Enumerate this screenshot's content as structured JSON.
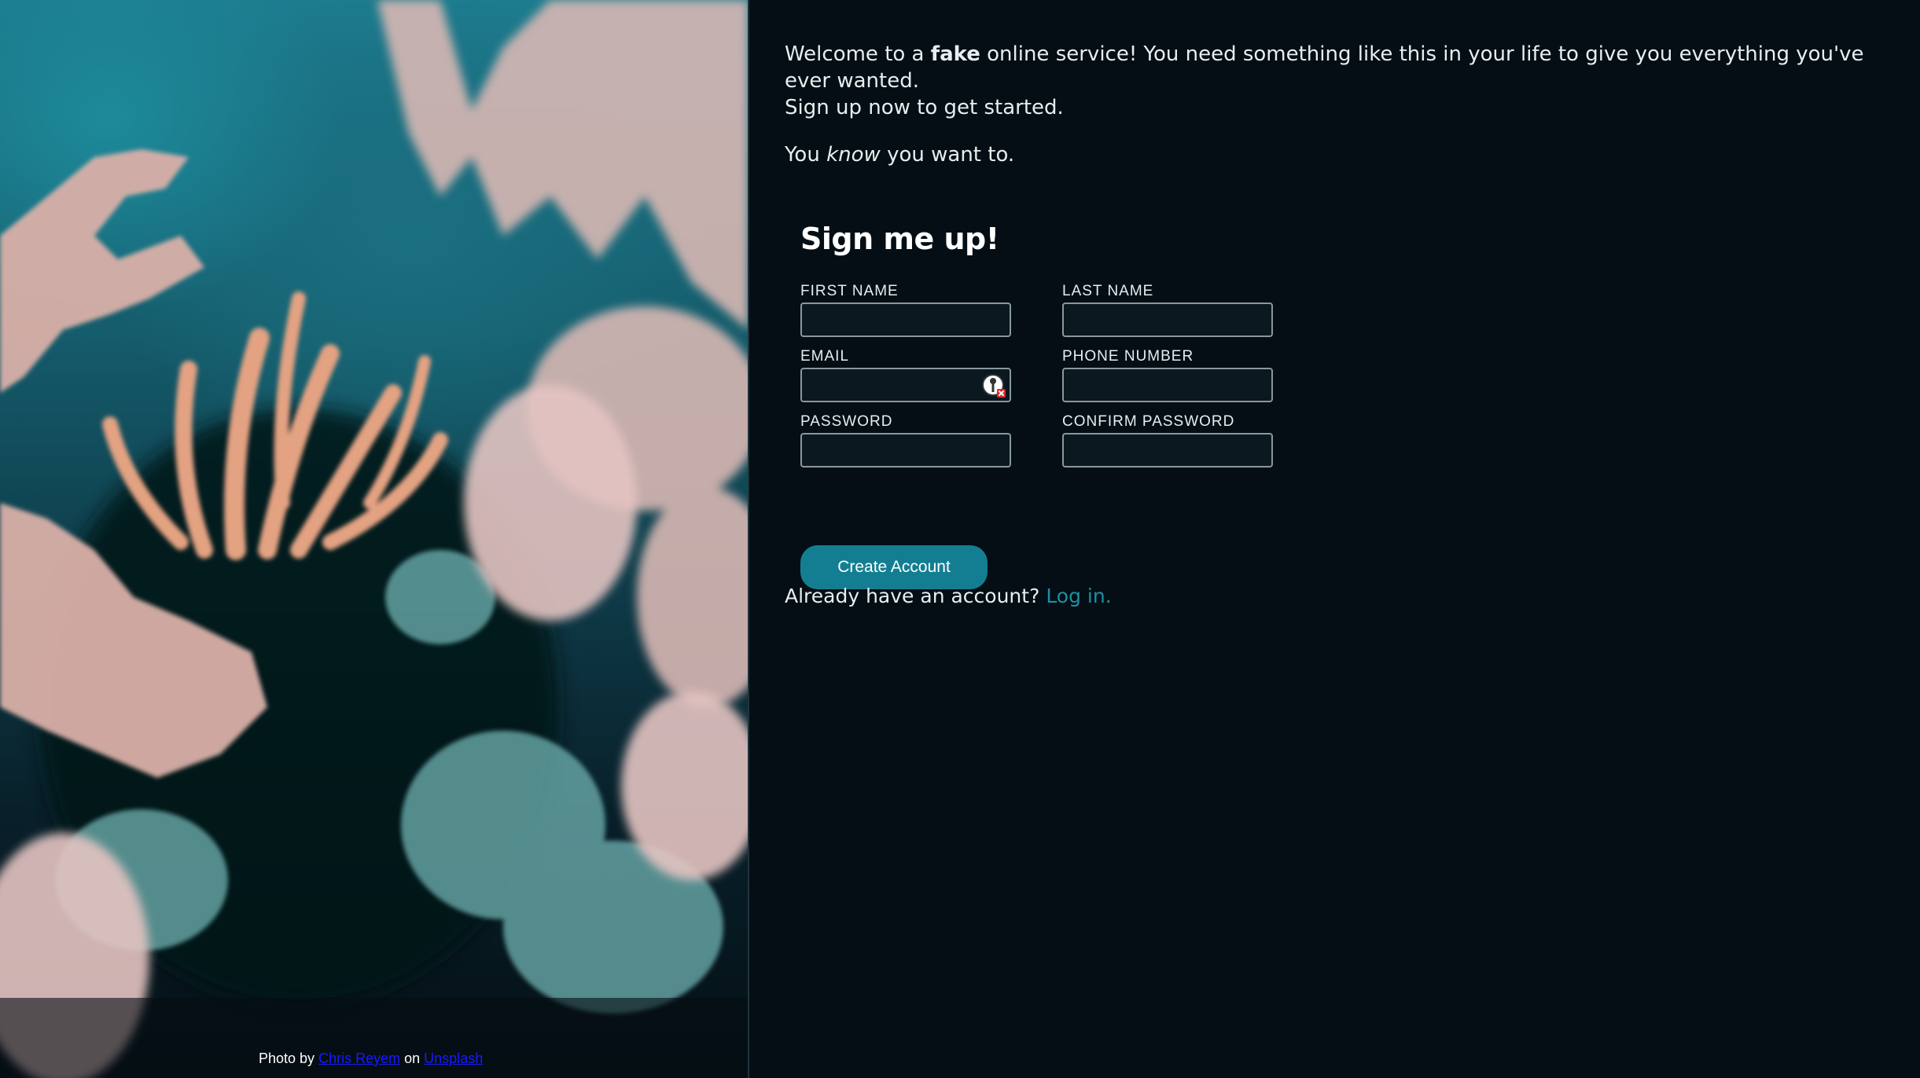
{
  "photo": {
    "credit_prefix": "Photo by",
    "photographer": "Chris Reyem",
    "credit_on": "on",
    "source": "Unsplash"
  },
  "intro": {
    "line1_before": "Welcome to a",
    "line1_bold": "fake",
    "line1_after": "online service! You need something like this in your life to give you everything you've ever wanted.",
    "line2": "Sign up now to get started.",
    "tagline_before": "You",
    "tagline_italic": "know",
    "tagline_after": "you want to."
  },
  "form": {
    "title": "Sign me up!",
    "fields": {
      "first_name": "FIRST NAME",
      "last_name": "LAST NAME",
      "email": "EMAIL",
      "phone": "PHONE NUMBER",
      "password": "PASSWORD",
      "confirm_password": "CONFIRM PASSWORD"
    },
    "submit_label": "Create Account"
  },
  "login": {
    "prompt": "Already have an account?",
    "link_label": "Log in."
  },
  "colors": {
    "background": "#040e14",
    "accent": "#137e92",
    "link": "#1e8fa5"
  }
}
